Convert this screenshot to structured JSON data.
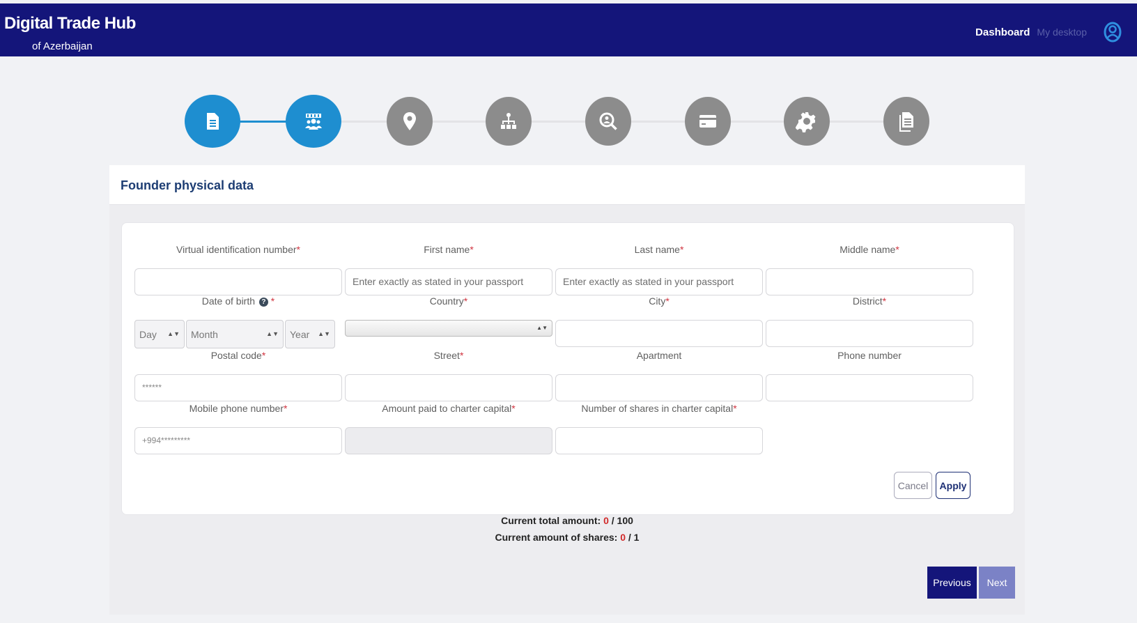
{
  "header": {
    "title": "Digital Trade Hub",
    "subtitle": "of Azerbaijan",
    "dashboard": "Dashboard",
    "my_desktop": "My desktop",
    "user_icon": "user-circle-icon"
  },
  "stepper": {
    "steps": [
      {
        "icon": "document-icon",
        "active": true
      },
      {
        "icon": "founders-icon",
        "active": true
      },
      {
        "icon": "location-pin-icon",
        "active": false
      },
      {
        "icon": "hierarchy-icon",
        "active": false
      },
      {
        "icon": "search-people-icon",
        "active": false
      },
      {
        "icon": "card-icon",
        "active": false
      },
      {
        "icon": "settings-gear-icon",
        "active": false
      },
      {
        "icon": "documents-icon",
        "active": false
      }
    ]
  },
  "card": {
    "title": "Founder physical data"
  },
  "form": {
    "vin": {
      "label": "Virtual identification number",
      "req": "*",
      "value": ""
    },
    "first_name": {
      "label": "First name",
      "req": "*",
      "placeholder": "Enter exactly as stated in your passport"
    },
    "last_name": {
      "label": "Last name",
      "req": "*",
      "placeholder": "Enter exactly as stated in your passport"
    },
    "middle_name": {
      "label": "Middle name",
      "req": "*",
      "value": ""
    },
    "dob": {
      "label": "Date of birth",
      "help": "?",
      "req": " *",
      "day": "Day",
      "month": "Month",
      "year": "Year"
    },
    "country": {
      "label": "Country",
      "req": "*",
      "value": ""
    },
    "city": {
      "label": "City",
      "req": "*",
      "value": ""
    },
    "district": {
      "label": "District",
      "req": "*",
      "value": ""
    },
    "postal": {
      "label": "Postal code",
      "req": "*",
      "placeholder": "******"
    },
    "street": {
      "label": "Street",
      "req": "*",
      "value": ""
    },
    "apartment": {
      "label": "Apartment",
      "value": ""
    },
    "phone": {
      "label": "Phone number",
      "value": ""
    },
    "mobile": {
      "label": "Mobile phone number",
      "req": "*",
      "placeholder": "+994*********"
    },
    "amount_paid": {
      "label": "Amount paid to charter capital",
      "req": "*",
      "value": ""
    },
    "shares": {
      "label": "Number of shares in charter capital",
      "req": "*",
      "value": ""
    },
    "cancel": "Cancel",
    "apply": "Apply"
  },
  "totals": {
    "amount_label": "Current total amount: ",
    "amount_current": "0",
    "amount_max": " / 100",
    "shares_label": "Current amount of shares: ",
    "shares_current": "0",
    "shares_max": " / 1"
  },
  "nav": {
    "previous": "Previous",
    "next": "Next"
  },
  "colors": {
    "header_bg": "#14157a",
    "step_active": "#1e8ed0",
    "step_inactive": "#8c8c8c",
    "required": "#d0333f"
  }
}
